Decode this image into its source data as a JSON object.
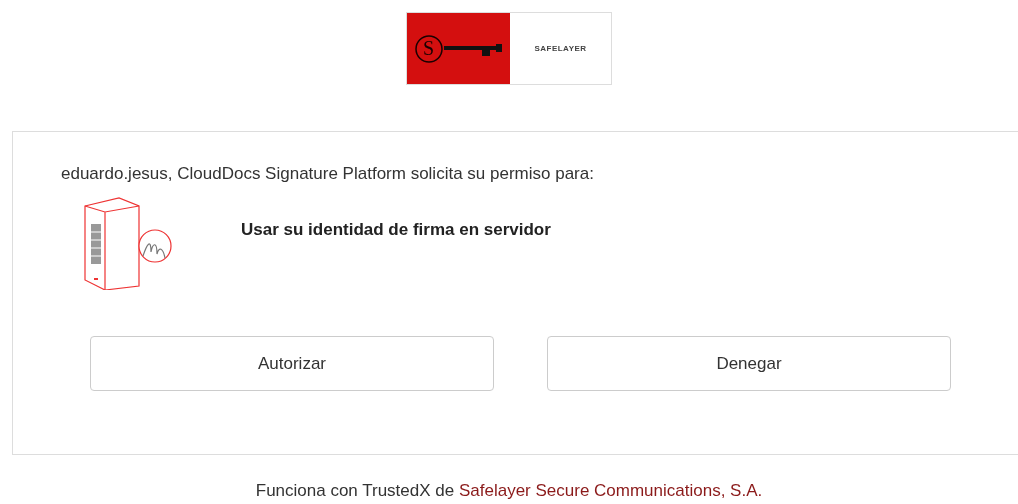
{
  "logo": {
    "mark": "S",
    "name": "SAFELAYER"
  },
  "request": {
    "intro": "eduardo.jesus, CloudDocs Signature Platform solicita su permiso para:",
    "permission": "Usar su identidad de firma en servidor"
  },
  "buttons": [
    {
      "label": "Autorizar"
    },
    {
      "label": "Denegar"
    }
  ],
  "footer": {
    "text": "Funciona con TrustedX de ",
    "link": "Safelayer Secure Communications, S.A."
  }
}
